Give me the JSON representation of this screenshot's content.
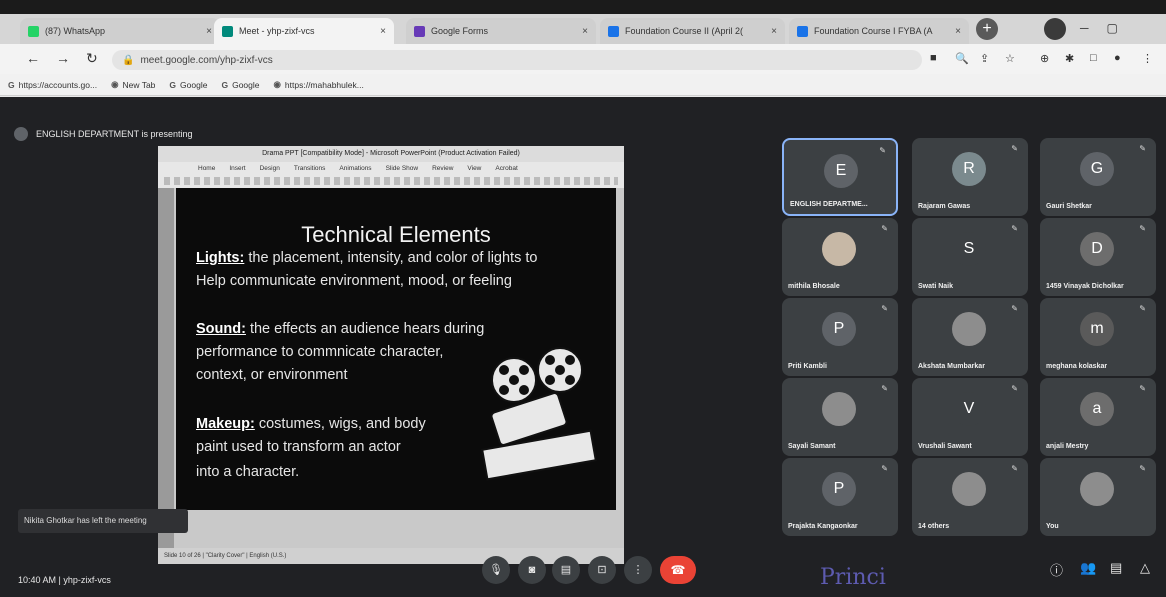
{
  "browser": {
    "tabs": [
      {
        "label": "(87) WhatsApp",
        "close": "×",
        "fav_color": "#25d366"
      },
      {
        "label": "Meet - yhp-zixf-vcs",
        "close": "×",
        "fav_color": "#00897b"
      },
      {
        "label": "Google Forms",
        "close": "×",
        "fav_color": "#673ab7"
      },
      {
        "label": "Foundation Course II (April 2(",
        "close": "×",
        "fav_color": "#1a73e8"
      },
      {
        "label": "Foundation Course I FYBA (A",
        "close": "×",
        "fav_color": "#1a73e8"
      }
    ],
    "new_tab": "+",
    "url": "meet.google.com/yhp-zixf-vcs",
    "bookmarks": [
      {
        "icon": "G",
        "label": "https://accounts.go..."
      },
      {
        "icon": "◉",
        "label": "New Tab"
      },
      {
        "icon": "G",
        "label": "Google"
      },
      {
        "icon": "G",
        "label": "Google"
      },
      {
        "icon": "◉",
        "label": "https://mahabhulek..."
      }
    ]
  },
  "meet": {
    "presenting_text": "ENGLISH DEPARTMENT is presenting",
    "slide_window_title": "Drama PPT [Compatibility Mode] - Microsoft PowerPoint (Product Activation Failed)",
    "ribbon_tabs": [
      "Home",
      "Insert",
      "Design",
      "Transitions",
      "Animations",
      "Slide Show",
      "Review",
      "View",
      "Acrobat"
    ],
    "slide_status": "Slide 10 of 26  |  \"Clarity Cover\"  |  English (U.S.)",
    "slide": {
      "heading": "Technical Elements",
      "lights_label": "Lights:",
      "lights_text_1": " the placement, intensity, and color of lights to",
      "lights_text_2": "Help communicate environment, mood, or feeling",
      "sound_label": "Sound:",
      "sound_text_1": " the effects an audience hears during",
      "sound_text_2": "performance to commnicate character,",
      "sound_text_3": "context, or environment",
      "makeup_label": "Makeup:",
      "makeup_text_1": " costumes, wigs, and body",
      "makeup_text_2": "paint used to transform an actor",
      "makeup_text_3": "into a character."
    },
    "notification": "Nikita Ghotkar has left the meeting",
    "clock": "10:40 AM  |  yhp-zixf-vcs",
    "participants": [
      {
        "initial": "E",
        "name": "ENGLISH DEPARTME...",
        "color": "#5f6368"
      },
      {
        "initial": "R",
        "name": "Rajaram Gawas",
        "color": "#7b8a8e"
      },
      {
        "initial": "G",
        "name": "Gauri Shetkar",
        "color": "#5f6368"
      },
      {
        "initial": "",
        "name": "mithila Bhosale",
        "color": "#c7b8a6"
      },
      {
        "initial": "S",
        "name": "Swati Naik",
        "color": "#3c4043"
      },
      {
        "initial": "D",
        "name": "1459 Vinayak Dicholkar",
        "color": "#6d6d6d"
      },
      {
        "initial": "P",
        "name": "Priti Kambli",
        "color": "#5f6368"
      },
      {
        "initial": "",
        "name": "Akshata Mumbarkar",
        "color": "#8d8d8d"
      },
      {
        "initial": "m",
        "name": "meghana kolaskar",
        "color": "#5a5a5a"
      },
      {
        "initial": "",
        "name": "Sayali Samant",
        "color": "#8d8d8d"
      },
      {
        "initial": "V",
        "name": "Vrushali Sawant",
        "color": "#3c4043"
      },
      {
        "initial": "a",
        "name": "anjali Mestry",
        "color": "#6d6d6d"
      },
      {
        "initial": "P",
        "name": "Prajakta Kangaonkar",
        "color": "#5f6368"
      },
      {
        "initial": "",
        "name": "14 others",
        "color": "#8d8d8d"
      },
      {
        "initial": "",
        "name": "You",
        "color": "#8d8d8d"
      }
    ],
    "stamp_text": "Princi"
  }
}
